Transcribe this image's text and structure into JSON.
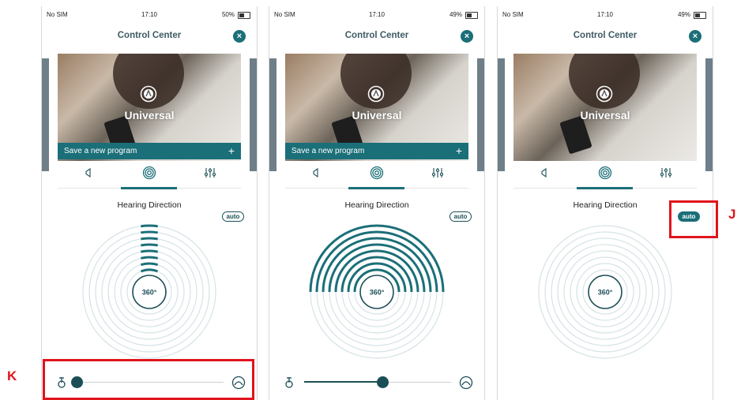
{
  "screens": [
    {
      "carrier": "No SIM",
      "time": "17:10",
      "battery": "50%",
      "battery_level": 0.5,
      "title": "Control Center",
      "close_label": "×",
      "program_name": "Universal",
      "save_label": "Save a new program",
      "add_label": "+",
      "hearing_direction_label": "Hearing Direction",
      "auto_label": "auto",
      "auto_on": false,
      "center_label": "360°",
      "mode": "narrow",
      "slider_value": 0.0
    },
    {
      "carrier": "No SIM",
      "time": "17:10",
      "battery": "49%",
      "battery_level": 0.49,
      "title": "Control Center",
      "close_label": "×",
      "program_name": "Universal",
      "save_label": "Save a new program",
      "add_label": "+",
      "hearing_direction_label": "Hearing Direction",
      "auto_label": "auto",
      "auto_on": false,
      "center_label": "360°",
      "mode": "wide",
      "slider_value": 0.53
    },
    {
      "carrier": "No SIM",
      "time": "17:10",
      "battery": "49%",
      "battery_level": 0.49,
      "title": "Control Center",
      "close_label": "×",
      "program_name": "Universal",
      "save_label": "",
      "hearing_direction_label": "Hearing Direction",
      "auto_label": "auto",
      "auto_on": true,
      "center_label": "360°",
      "mode": "auto",
      "slider_value": null
    }
  ],
  "tabs": [
    {
      "icon": "speaker-icon"
    },
    {
      "icon": "hearing-direction-icon"
    },
    {
      "icon": "equalizer-icon"
    }
  ],
  "callouts": {
    "j": "J",
    "k": "K"
  },
  "colors": {
    "accent": "#1b6f78",
    "dark": "#1b4f57",
    "ring": "#d5e3e5",
    "highlight": "#e0141c"
  }
}
